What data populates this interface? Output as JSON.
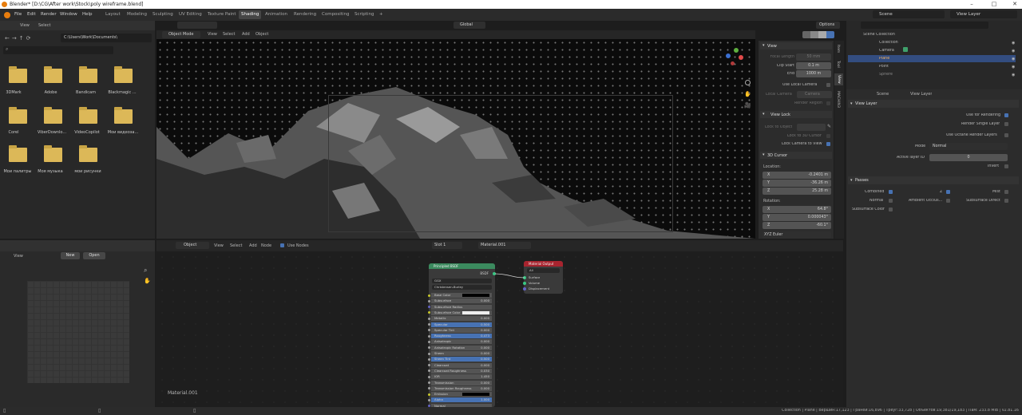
{
  "window": {
    "title": "Blender* [D:\\CG\\After work\\Stock\\poly wireframe.blend]"
  },
  "menu": [
    "File",
    "Edit",
    "Render",
    "Window",
    "Help"
  ],
  "workspaces": [
    "Layout",
    "Modeling",
    "Sculpting",
    "UV Editing",
    "Texture Paint",
    "Shading",
    "Animation",
    "Rendering",
    "Compositing",
    "Scripting",
    "+"
  ],
  "active_workspace": "Shading",
  "scene": {
    "scene_name": "Scene",
    "view_layer": "View Layer"
  },
  "file_browser": {
    "menu": [
      "View",
      "Select"
    ],
    "path": "C:\\Users\\Work\\Documents\\",
    "folders": [
      "3DMark",
      "Adobe",
      "Bandicam",
      "Blackmagic ...",
      "Corel",
      "ViberDownlo...",
      "VideoCopilot",
      "Мои видеоза...",
      "Мои палитры",
      "Моя музыка",
      "мои рисунки"
    ]
  },
  "viewport": {
    "mode": "Object Mode",
    "menu": [
      "View",
      "Select",
      "Add",
      "Object"
    ],
    "orientation": "Global",
    "options_label": "Options",
    "tabs": [
      "Item",
      "Tool",
      "View",
      "MACHIN3"
    ],
    "view_panel": {
      "header": "View",
      "focal_length_label": "Focal Length",
      "focal_length": "50 mm",
      "clip_start_label": "Clip Start",
      "clip_start": "0.1 m",
      "end_label": "End",
      "clip_end": "1000 m",
      "use_local_camera": "Use Local Camera",
      "local_camera_label": "Local Camera",
      "local_camera": "Camera",
      "render_region": "Render Region"
    },
    "view_lock": {
      "header": "View Lock",
      "lock_to_object": "Lock to Object",
      "lock_to_3d_cursor": "Lock to 3D Cursor",
      "lock_camera_to_view": "Lock Camera to View"
    },
    "cursor": {
      "header": "3D Cursor",
      "location_label": "Location:",
      "x": "-0.2401 m",
      "y": "-36.26 m",
      "z": "25.28 m",
      "rotation_label": "Rotation:",
      "rx": "64.8°",
      "ry": "0.000043°",
      "rz": "-60.1°",
      "rot_mode": "XYZ Euler"
    }
  },
  "outliner": {
    "items": [
      {
        "name": "Scene Collection"
      },
      {
        "name": "Collection"
      },
      {
        "name": "Camera"
      },
      {
        "name": "Plane"
      },
      {
        "name": "Point"
      },
      {
        "name": "Sphere"
      }
    ]
  },
  "properties": {
    "scene": "Scene",
    "view_layer": "View Layer",
    "panel": "View Layer",
    "use_for_rendering": "Use for Rendering",
    "render_single_layer": "Render Single Layer",
    "use_octane": "Use Octane Render Layers",
    "mode_label": "Mode",
    "mode": "Normal",
    "active_layer_label": "Active layer ID",
    "active_layer": "0",
    "invert": "Invert",
    "passes_header": "Passes",
    "combined": "Combined",
    "z": "Z",
    "mist": "Mist",
    "normal": "Normal",
    "ambient": "Ambient Occlus...",
    "subsurface_direct": "Subsurface Direct",
    "subsurface_color": "Subsurface Color"
  },
  "image_editor": {
    "view": "View",
    "new": "New",
    "open": "Open"
  },
  "node_editor": {
    "type": "Object",
    "menu": [
      "View",
      "Select",
      "Add",
      "Node"
    ],
    "use_nodes": "Use Nodes",
    "slot": "Slot 1",
    "material": "Material.001",
    "material_label": "Material.001",
    "bsdf": {
      "title": "Principled BSDF",
      "out": "BSDF",
      "dist": "GGX",
      "sss": "Christensen-Burley",
      "rows": [
        "Base Color",
        "Subsurface",
        "Subsurface Radius",
        "Subsurface Color",
        "Metallic",
        "Specular",
        "Specular Tint",
        "Roughness",
        "Anisotropic",
        "Anisotropic Rotation",
        "Sheen",
        "Sheen Tint",
        "Clearcoat",
        "Clearcoat Roughness",
        "IOR",
        "Transmission",
        "Transmission Roughness",
        "Emission",
        "Alpha",
        "Normal"
      ],
      "vals": [
        "",
        "0.000",
        "",
        "",
        "0.000",
        "0.500",
        "0.000",
        "0.473",
        "0.000",
        "0.000",
        "0.000",
        "0.500",
        "0.000",
        "0.030",
        "1.450",
        "0.000",
        "0.000",
        "",
        "1.000",
        ""
      ]
    },
    "output": {
      "title": "Material Output",
      "target": "All",
      "sockets": [
        "Surface",
        "Volume",
        "Displacement"
      ]
    }
  },
  "status": "Collection | Plane | Вершин:17,123 | Граней:16,896 | Треуг:33,728 | Объектов:19,381/19,183 | Пам: 233.8 MiB | v2.81.16"
}
